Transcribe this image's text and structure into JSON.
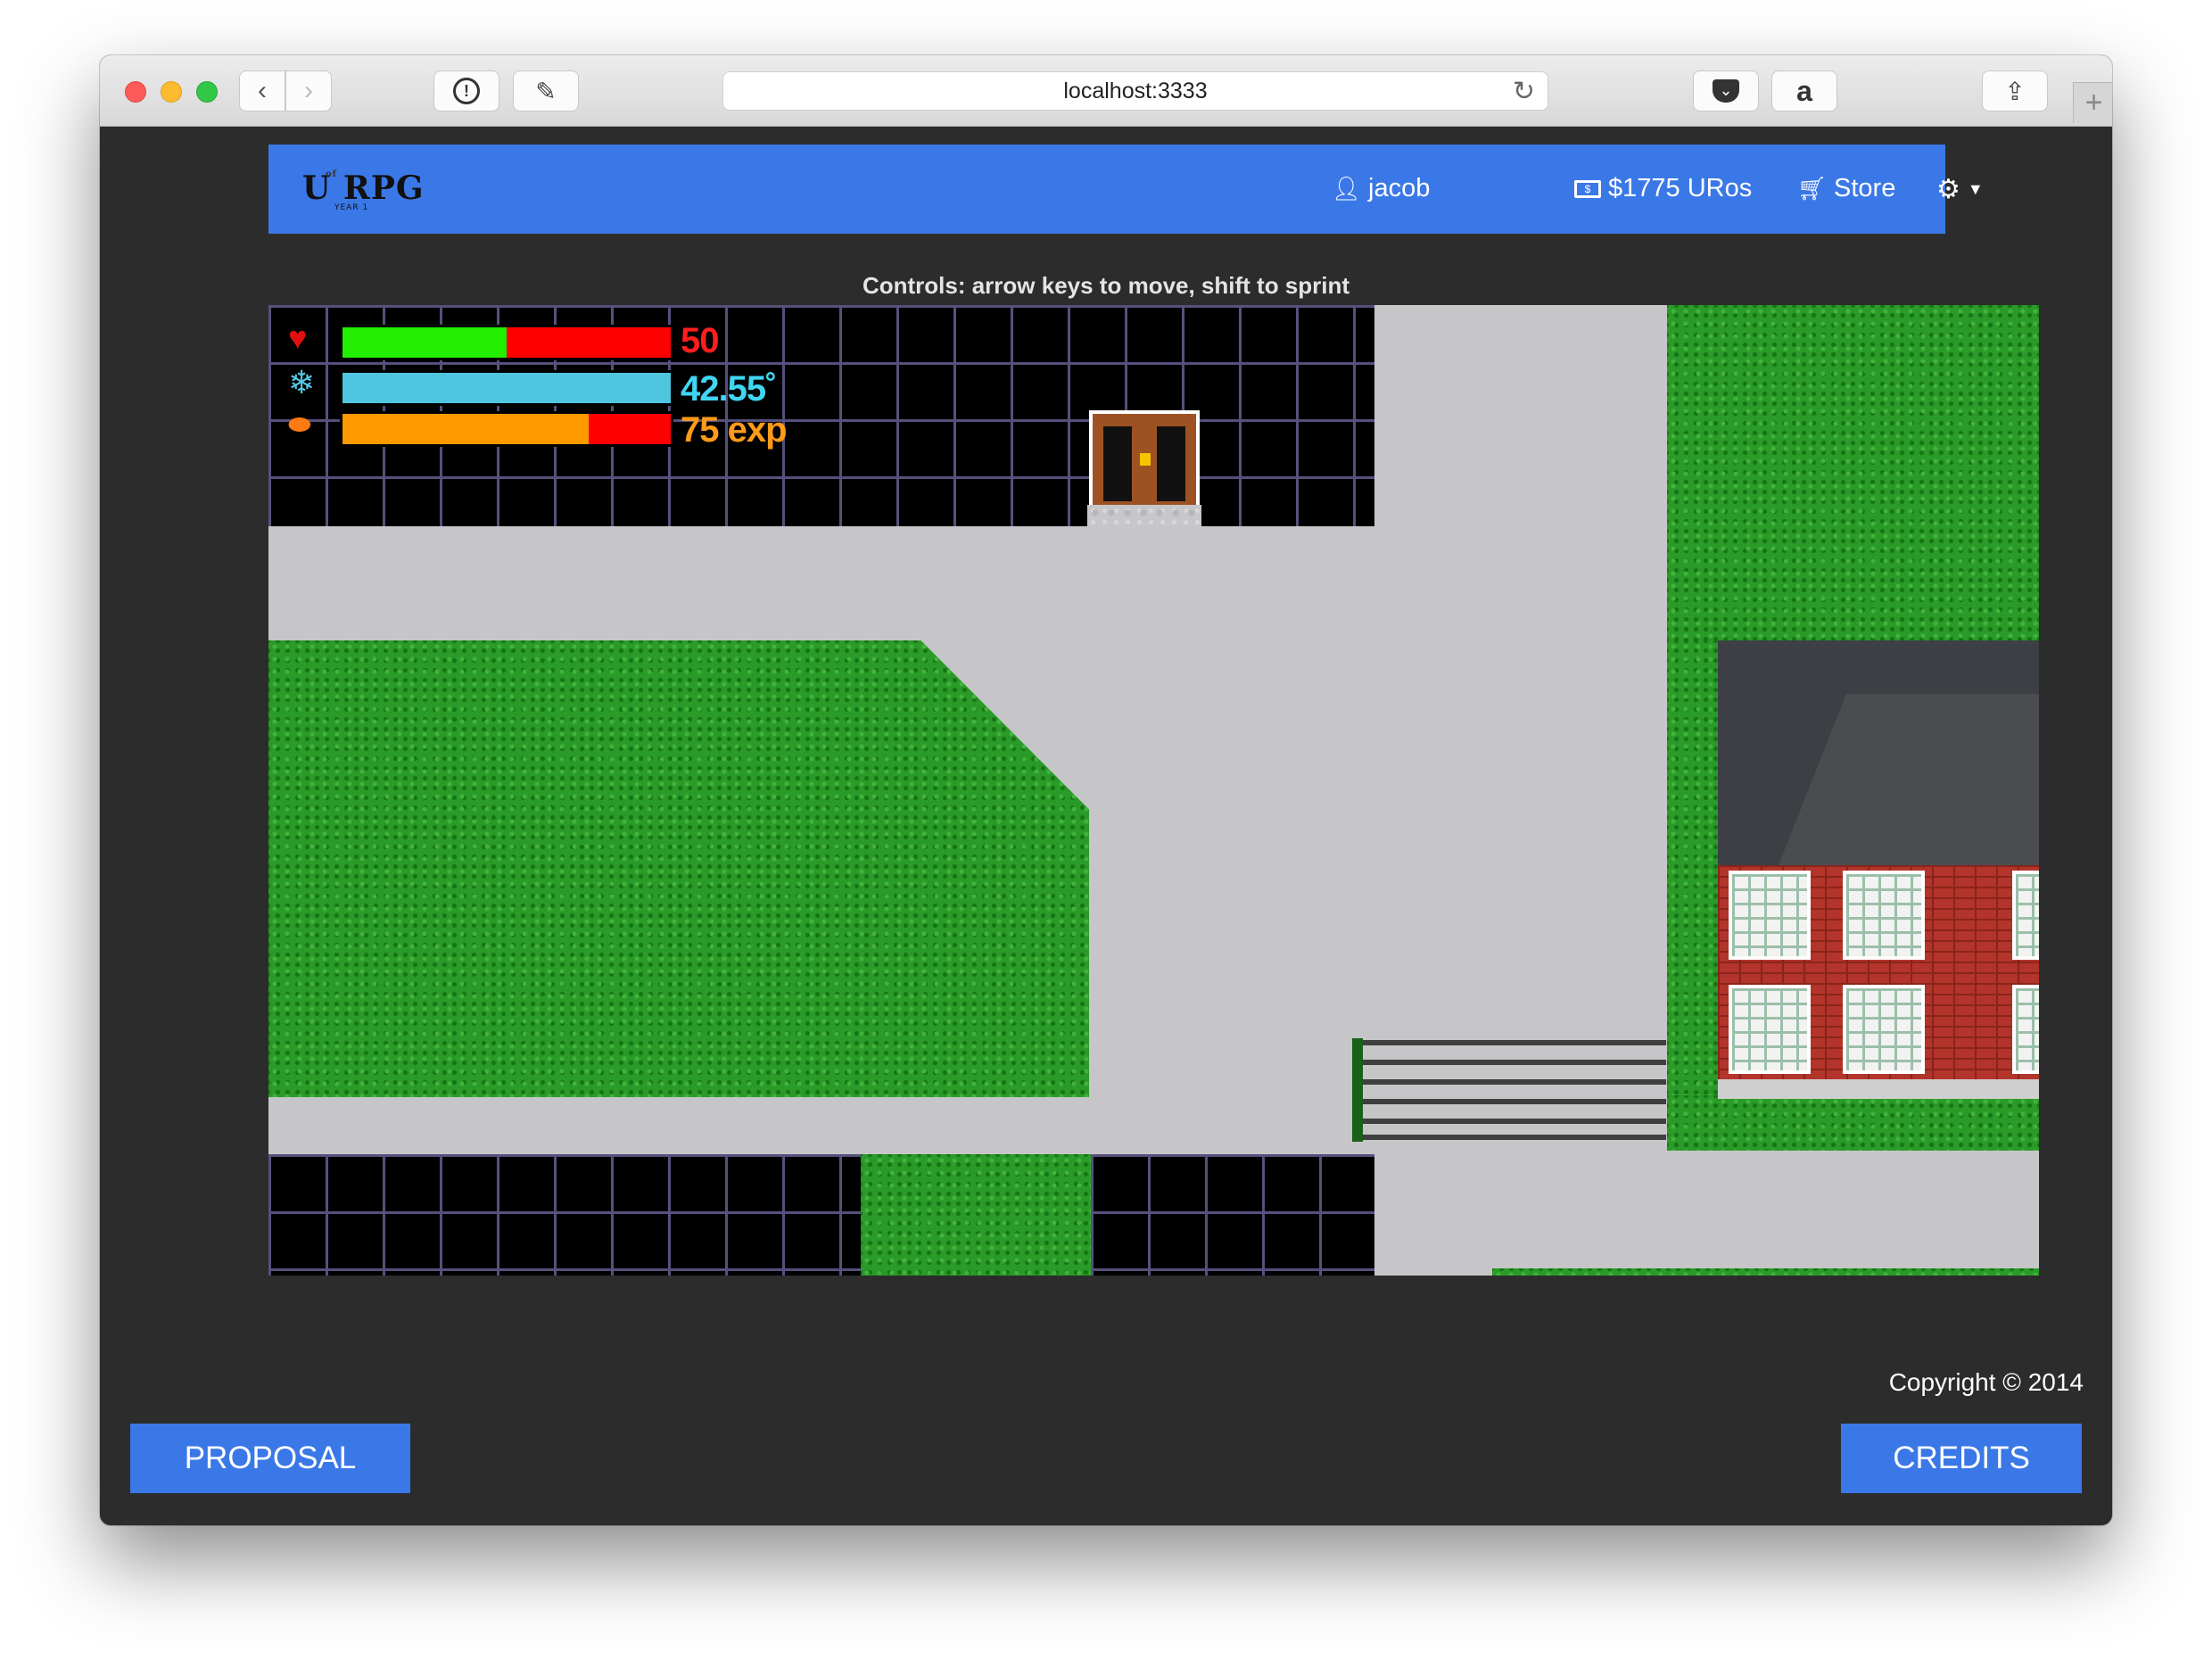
{
  "browser": {
    "url": "localhost:3333"
  },
  "navbar": {
    "logo": "U RPG",
    "logo_small": "of",
    "logo_sub": "YEAR 1",
    "username": "jacob",
    "balance": "$1775 URos",
    "store": "Store"
  },
  "game": {
    "controls": "Controls: arrow keys to move, shift to sprint",
    "hud": {
      "health_value": "50",
      "health_fraction": 0.5,
      "temperature_value": "42.55˚",
      "temperature_fraction": 1.0,
      "exp_value": "75 exp",
      "exp_fraction": 0.75
    },
    "colors": {
      "health": "#22ee00",
      "empty": "#ff0000",
      "temperature": "#4ec6e0",
      "exp": "#ff9900",
      "health_text": "#ff1e1e",
      "temperature_text": "#3fd6f2",
      "exp_text": "#ff9a1a"
    }
  },
  "footer": {
    "copyright": "Copyright © 2014",
    "proposal_button": "PROPOSAL",
    "credits_button": "CREDITS"
  },
  "theme": {
    "accent": "#3b78e7",
    "page_background": "#2c2c2c"
  }
}
